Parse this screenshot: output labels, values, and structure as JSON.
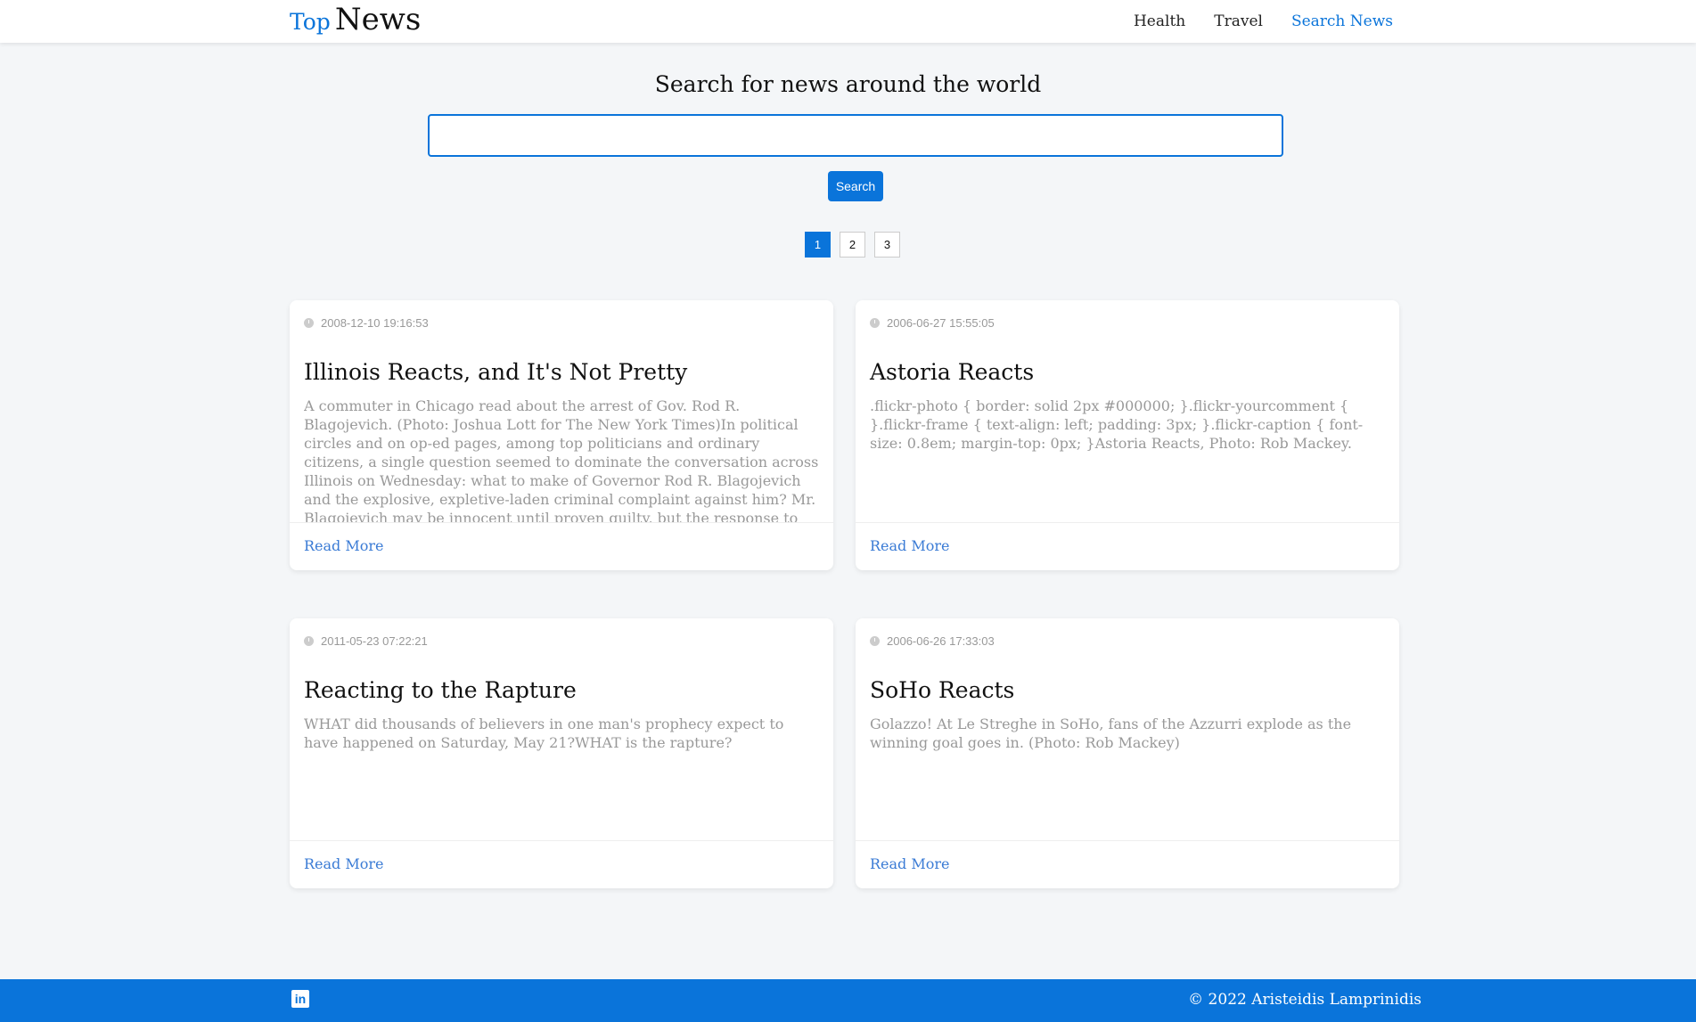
{
  "brand": {
    "top": "Top",
    "news": "News"
  },
  "nav": {
    "items": [
      {
        "label": "Health"
      },
      {
        "label": "Travel"
      },
      {
        "label": "Search News"
      }
    ]
  },
  "search": {
    "heading": "Search for news around the world",
    "value": "",
    "button_label": "Search"
  },
  "pagination": {
    "pages": [
      "1",
      "2",
      "3"
    ],
    "current": "1"
  },
  "articles": [
    {
      "date": "2008-12-10 19:16:53",
      "title": "Illinois Reacts, and It's Not Pretty",
      "body": "A commuter in Chicago read about the arrest of Gov. Rod R. Blagojevich. (Photo: Joshua Lott for The New York Times)In political circles and on op-ed pages, among top politicians and ordinary citizens, a single question seemed to dominate the conversation across Illinois on Wednesday: what to make of Governor Rod R. Blagojevich and the explosive, expletive-laden criminal complaint against him? Mr. Blagojevich may be innocent until proven guilty, but the response to the accusations that he sought to auction off, among",
      "read_more": "Read More"
    },
    {
      "date": "2006-06-27 15:55:05",
      "title": "Astoria Reacts",
      "body": ".flickr-photo { border: solid 2px #000000; }.flickr-yourcomment { }.flickr-frame { text-align: left; padding: 3px; }.flickr-caption { font-size: 0.8em; margin-top: 0px; }Astoria Reacts, Photo: Rob Mackey.",
      "read_more": "Read More"
    },
    {
      "date": "2011-05-23 07:22:21",
      "title": "Reacting to the Rapture",
      "body": "WHAT did thousands of believers in one man's prophecy expect to have happened on Saturday, May 21?WHAT is the rapture?",
      "read_more": "Read More"
    },
    {
      "date": "2006-06-26 17:33:03",
      "title": "SoHo Reacts",
      "body": "Golazzo! At Le Streghe in SoHo, fans of the Azzurri explode as the winning goal goes in. (Photo: Rob Mackey)",
      "read_more": "Read More"
    }
  ],
  "footer": {
    "linkedin_icon": "linkedin-icon",
    "copyright": "© 2022 Aristeidis Lamprinidis"
  },
  "colors": {
    "accent": "#0a74da",
    "background": "#f4f6f8"
  }
}
